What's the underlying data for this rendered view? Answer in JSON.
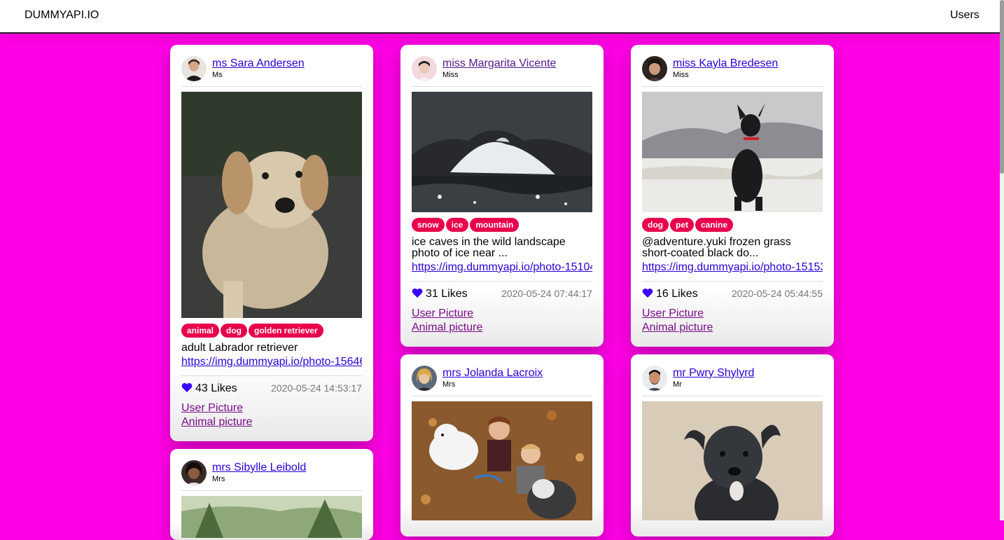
{
  "navbar": {
    "brand": "DUMMYAPI.IO",
    "users_link": "Users"
  },
  "colors": {
    "background": "#ff00e6",
    "tag": "#e8004c",
    "heart": "#3a00ff"
  },
  "posts": [
    {
      "owner_name": "ms Sara Andersen",
      "owner_title": "Ms",
      "tags": [
        "animal",
        "dog",
        "golden retriever"
      ],
      "text": "adult Labrador retriever",
      "link": "https://img.dummyapi.io/photo-1564694202779-bc908c327862.jpg",
      "likes": "43 Likes",
      "date": "2020-05-24 14:53:17",
      "user_picture": "User Picture",
      "animal_picture": "Animal picture"
    },
    {
      "owner_name": "miss Margarita Vicente",
      "owner_title": "Miss",
      "tags": [
        "snow",
        "ice",
        "mountain"
      ],
      "text": "ice caves in the wild landscape photo of ice near ...",
      "link": "https://img.dummyapi.io/photo-1510414696678-2415ad8474aa.jpg",
      "likes": "31 Likes",
      "date": "2020-05-24 07:44:17",
      "user_picture": "User Picture",
      "animal_picture": "Animal picture"
    },
    {
      "owner_name": "miss Kayla Bredesen",
      "owner_title": "Miss",
      "tags": [
        "dog",
        "pet",
        "canine"
      ],
      "text": "@adventure.yuki frozen grass short-coated black do...",
      "link": "https://img.dummyapi.io/photo-1515376721779-7db6951da88d.jpg",
      "likes": "16 Likes",
      "date": "2020-05-24 05:44:55",
      "user_picture": "User Picture",
      "animal_picture": "Animal picture"
    },
    {
      "owner_name": "mrs Sibylle Leibold",
      "owner_title": "Mrs"
    },
    {
      "owner_name": "mrs Jolanda Lacroix",
      "owner_title": "Mrs"
    },
    {
      "owner_name": "mr Pwry Shylyrd",
      "owner_title": "Mr"
    }
  ]
}
